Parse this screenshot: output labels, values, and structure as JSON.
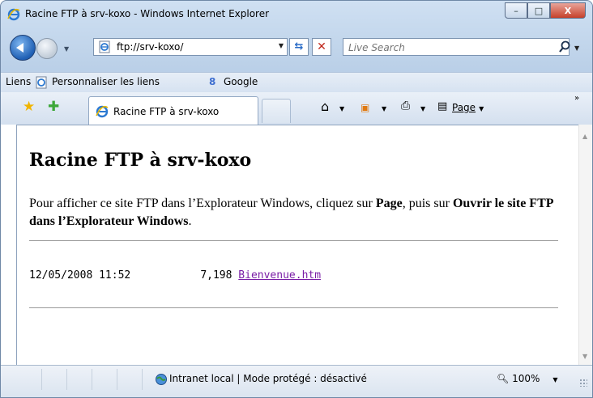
{
  "window": {
    "title": "Racine FTP à srv-koxo - Windows Internet Explorer",
    "buttons": {
      "minimize": "–",
      "maximize": "□",
      "close": "X"
    }
  },
  "navigation": {
    "address": "ftp://srv-koxo/",
    "search_placeholder": "Live Search"
  },
  "links_bar": {
    "label": "Liens",
    "items": [
      "Personnaliser les liens",
      "Google"
    ]
  },
  "tabs": [
    {
      "label": "Racine FTP à srv-koxo",
      "active": true
    }
  ],
  "command_bar": {
    "page_label": "Page"
  },
  "content": {
    "heading": "Racine FTP à srv-koxo",
    "instruction_prefix": "Pour afficher ce site FTP dans l’Explorateur Windows, cliquez sur ",
    "instruction_bold1": "Page",
    "instruction_middle": ", puis sur ",
    "instruction_bold2": "Ouvrir le site FTP dans l’Explorateur Windows",
    "instruction_suffix": ".",
    "listing": [
      {
        "date": "12/05/2008 11:52",
        "size": "7,198",
        "name": "Bienvenue.htm"
      }
    ]
  },
  "status_bar": {
    "zone_text": "Intranet local | Mode protégé : désactivé",
    "zoom": "100%"
  },
  "colors": {
    "visited_link": "#7a1ea6",
    "frame": "#b7cde6"
  }
}
